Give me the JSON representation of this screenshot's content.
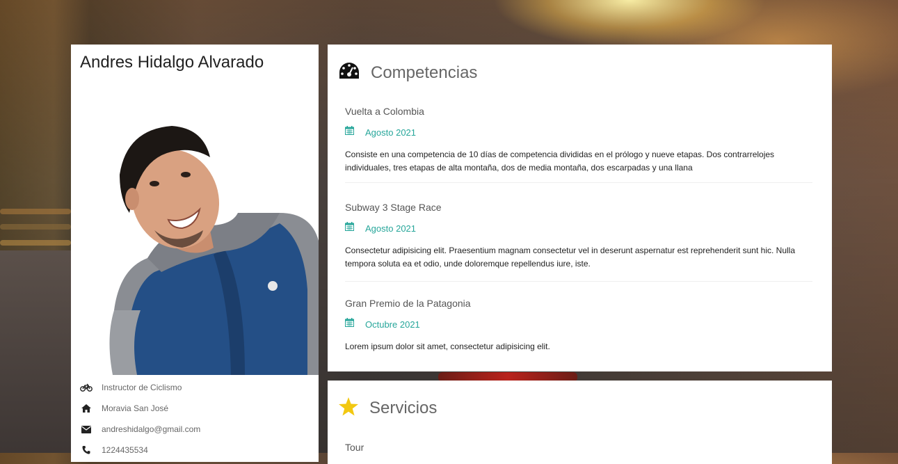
{
  "profile": {
    "name": "Andres Hidalgo Alvarado",
    "info": [
      {
        "icon": "bicycle-icon",
        "text": "Instructor de Ciclismo"
      },
      {
        "icon": "home-icon",
        "text": "Moravia San José"
      },
      {
        "icon": "envelope-icon",
        "text": "andreshidalgo@gmail.com"
      },
      {
        "icon": "phone-icon",
        "text": "1224435534"
      }
    ]
  },
  "competencias": {
    "title": "Competencias",
    "icon": "dashboard-icon",
    "entries": [
      {
        "title": "Vuelta a Colombia",
        "date": "Agosto 2021",
        "description": "Consiste en una competencia de 10 días de competencia divididas en el prólogo y nueve etapas. Dos contrarrelojes individuales, tres etapas de alta montaña, dos de media montaña, dos escarpadas y una llana"
      },
      {
        "title": "Subway 3 Stage Race",
        "date": "Agosto 2021",
        "description": "Consectetur adipisicing elit. Praesentium magnam consectetur vel in deserunt aspernatur est reprehenderit sunt hic. Nulla tempora soluta ea et odio, unde doloremque repellendus iure, iste."
      },
      {
        "title": "Gran Premio de la Patagonia",
        "date": "Octubre 2021",
        "description": "Lorem ipsum dolor sit amet, consectetur adipisicing elit."
      }
    ]
  },
  "servicios": {
    "title": "Servicios",
    "icon": "star-icon",
    "first_item": "Tour"
  },
  "colors": {
    "accent": "#26a69a",
    "star": "#f2c811"
  }
}
